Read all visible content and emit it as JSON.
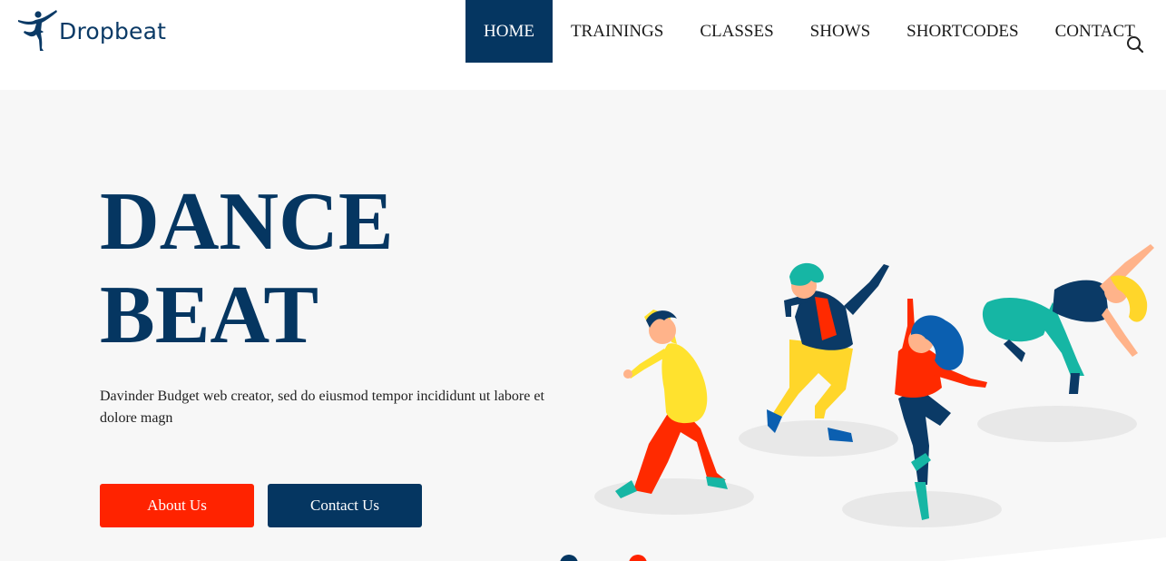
{
  "brand": {
    "name": "Dropbeat",
    "logo_icon": "dancer-silhouette-icon",
    "color": "#0b3a66"
  },
  "nav": {
    "items": [
      {
        "label": "HOME",
        "active": true
      },
      {
        "label": "TRAININGS",
        "active": false
      },
      {
        "label": "CLASSES",
        "active": false
      },
      {
        "label": "SHOWS",
        "active": false
      },
      {
        "label": "SHORTCODES",
        "active": false
      },
      {
        "label": "CONTACT",
        "active": false
      }
    ],
    "search_icon": "search-icon"
  },
  "hero": {
    "title_line1": "DANCE",
    "title_line2": "BEAT",
    "description": "Davinder Budget web creator, sed do eiusmod tempor incididunt ut labore et dolore magn",
    "about_button": "About Us",
    "contact_button": "Contact Us",
    "illustration": "four-dancers-illustration"
  },
  "colors": {
    "primary": "#053661",
    "accent": "#ff2300",
    "hero_bg": "#f7f7f7"
  }
}
